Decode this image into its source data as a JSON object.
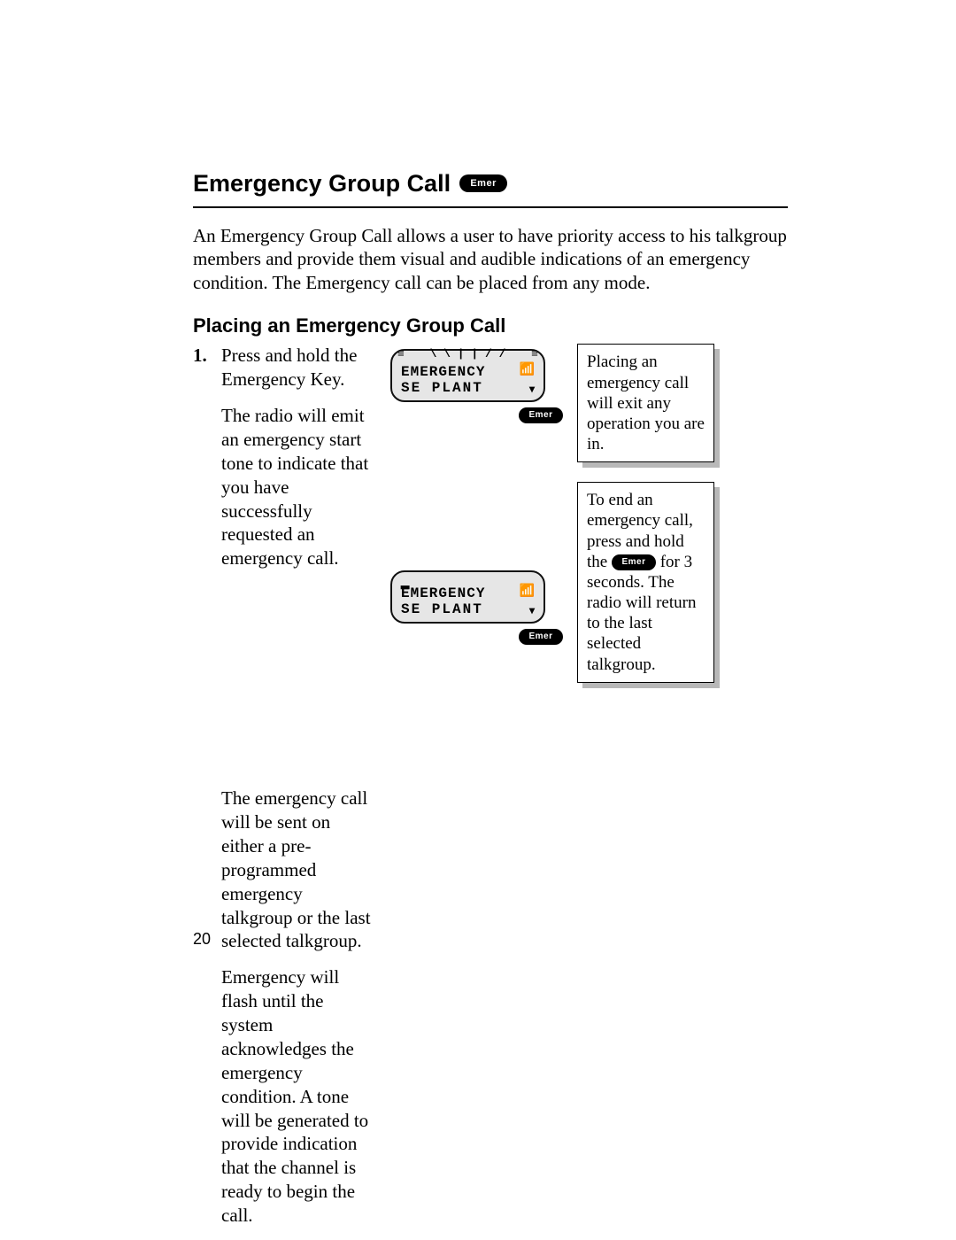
{
  "title": "Emergency Group Call",
  "title_icon_label": "Emer",
  "intro": "An Emergency Group Call allows a user to have priority access to his talkgroup members and provide them visual and audible indications of an emergency condition. The Emergency call can be placed from any mode.",
  "subtitle": "Placing an Emergency Group Call",
  "step_number": "1.",
  "step_text_a": "Press and hold the Emergency Key.",
  "step_text_b": "The radio will emit an emergency start tone to indicate that you have successfully requested an emergency call.",
  "step_text_c": "The emergency call will be sent on either a pre-programmed emergency talkgroup or the last selected talkgroup.",
  "step_text_d": "Emergency will flash until the system acknowledges the emergency condition.  A tone will be generated to provide indication that the channel is ready to begin the call.",
  "screen1": {
    "line1": "EMERGENCY",
    "line2": "SE PLANT",
    "signal_icon": "▂▃▅",
    "antenna_icon": "📶",
    "down_icon": "▾",
    "emer_below_label": "Emer",
    "flash_left": "≡",
    "flash_right": "≡",
    "flash_top": "\\ \\ | | / /"
  },
  "screen2": {
    "line1": "EMERGENCY",
    "line2": "SE PLANT",
    "signal_icon": "▂",
    "antenna_icon": "📶",
    "down_icon": "▾",
    "emer_below_label": "Emer"
  },
  "note1": "Placing an emergency call will exit any operation you are in.",
  "note2_a": "To end an emergency call, press and hold the ",
  "note2_icon_label": "Emer",
  "note2_b": " for 3 seconds. The radio will return to the last selected talkgroup.",
  "page_number": "20"
}
